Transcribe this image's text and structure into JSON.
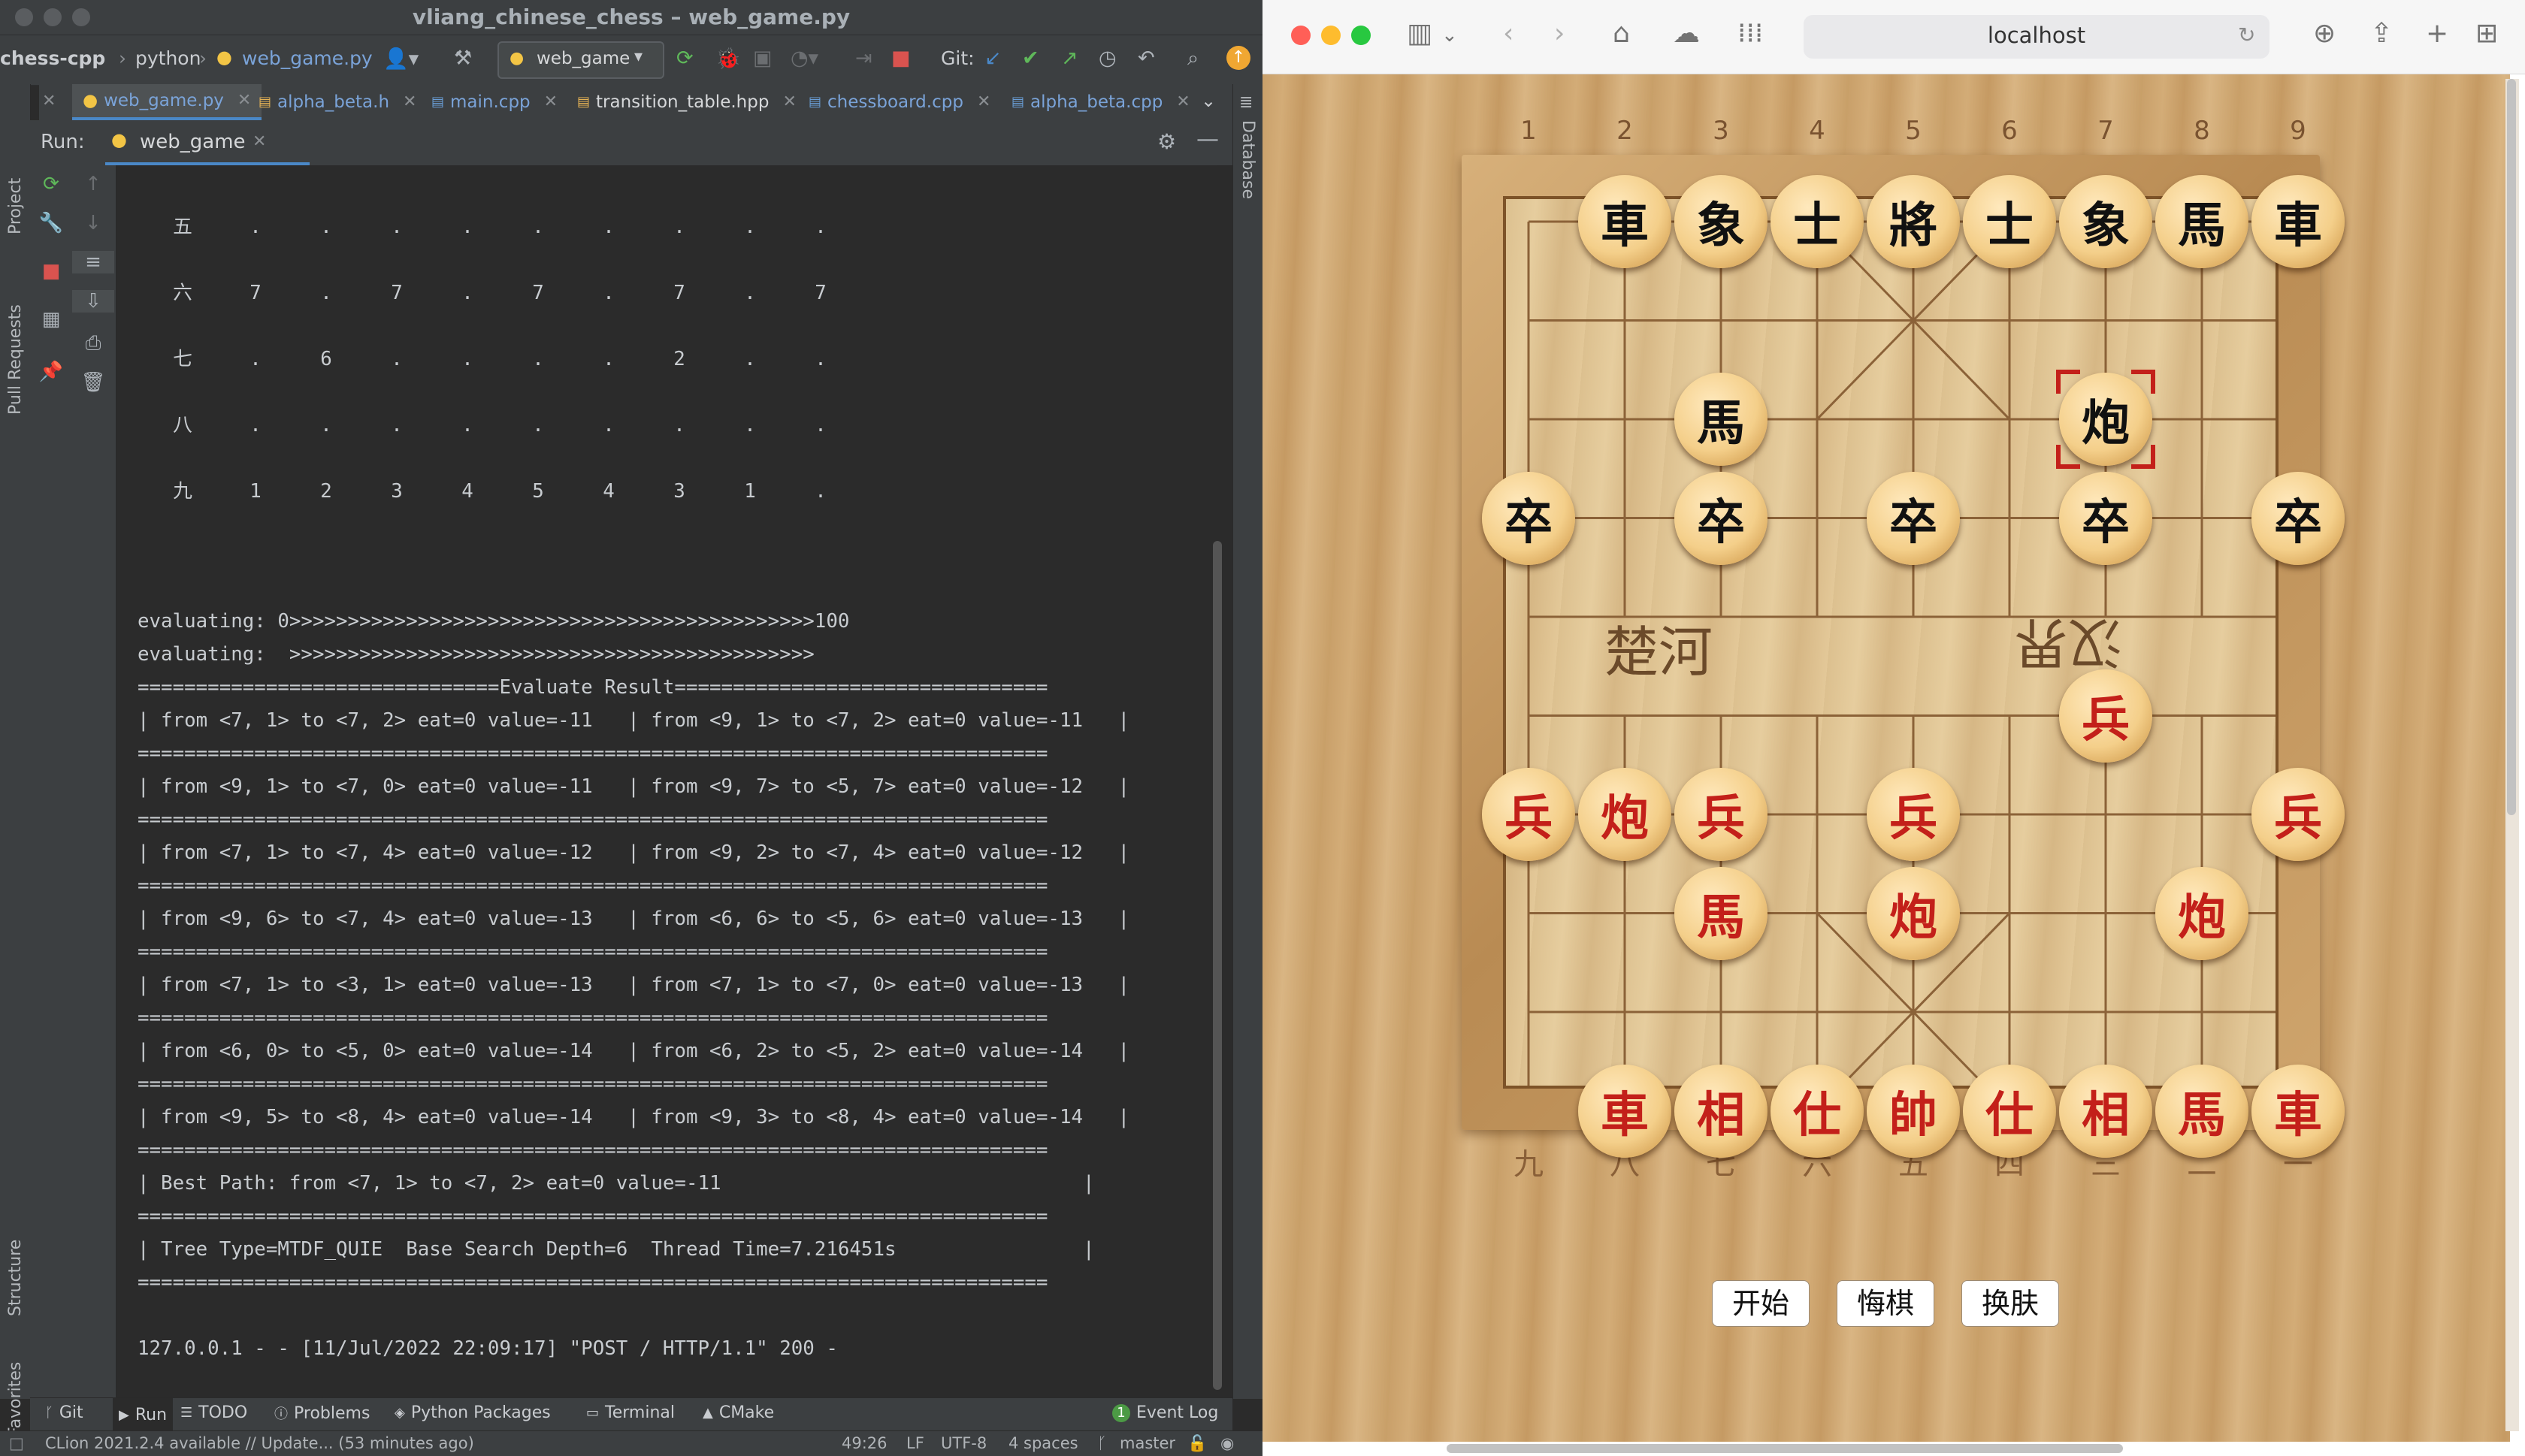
{
  "ide": {
    "title": "vliang_chinese_chess – web_game.py",
    "breadcrumb": {
      "project": "chess-cpp",
      "folder": "python",
      "file": "web_game.py"
    },
    "run_config": "web_game",
    "git_label": "Git:",
    "tabs": [
      {
        "label": "web_game.py",
        "active": true
      },
      {
        "label": "alpha_beta.h",
        "active": false
      },
      {
        "label": "main.cpp",
        "active": false
      },
      {
        "label": "transition_table.hpp",
        "active": false
      },
      {
        "label": "chessboard.cpp",
        "active": false
      },
      {
        "label": "alpha_beta.cpp",
        "active": false
      }
    ],
    "left_stripe": {
      "project": "Project",
      "pull_requests": "Pull Requests",
      "structure": "Structure",
      "favorites": "Favorites"
    },
    "right_stripe": {
      "database": "Database"
    },
    "run_label": "Run:",
    "run_tab": "web_game",
    "console": {
      "board_rows": [
        {
          "label": "五",
          "cells": [
            ".",
            ".",
            ".",
            ".",
            ".",
            ".",
            ".",
            ".",
            "."
          ]
        },
        {
          "label": "六",
          "cells": [
            "7",
            ".",
            "7",
            ".",
            "7",
            ".",
            "7",
            ".",
            "7"
          ]
        },
        {
          "label": "七",
          "cells": [
            ".",
            "6",
            ".",
            ".",
            ".",
            ".",
            "2",
            ".",
            "."
          ]
        },
        {
          "label": "八",
          "cells": [
            ".",
            ".",
            ".",
            ".",
            ".",
            ".",
            ".",
            ".",
            "."
          ]
        },
        {
          "label": "九",
          "cells": [
            "1",
            "2",
            "3",
            "4",
            "5",
            "4",
            "3",
            "1",
            "."
          ]
        }
      ],
      "lines": [
        "evaluating: 0>>>>>>>>>>>>>>>>>>>>>>>>>>>>>>>>>>>>>>>>>>>>>100",
        "evaluating:  >>>>>>>>>>>>>>>>>>>>>>>>>>>>>>>>>>>>>>>>>>>>>",
        "===============================Evaluate Result================================",
        "| from <7, 1> to <7, 2> eat=0 value=-11   | from <9, 1> to <7, 2> eat=0 value=-11   |",
        "==============================================================================",
        "| from <9, 1> to <7, 0> eat=0 value=-11   | from <9, 7> to <5, 7> eat=0 value=-12   |",
        "==============================================================================",
        "| from <7, 1> to <7, 4> eat=0 value=-12   | from <9, 2> to <7, 4> eat=0 value=-12   |",
        "==============================================================================",
        "| from <9, 6> to <7, 4> eat=0 value=-13   | from <6, 6> to <5, 6> eat=0 value=-13   |",
        "==============================================================================",
        "| from <7, 1> to <3, 1> eat=0 value=-13   | from <7, 1> to <7, 0> eat=0 value=-13   |",
        "==============================================================================",
        "| from <6, 0> to <5, 0> eat=0 value=-14   | from <6, 2> to <5, 2> eat=0 value=-14   |",
        "==============================================================================",
        "| from <9, 5> to <8, 4> eat=0 value=-14   | from <9, 3> to <8, 4> eat=0 value=-14   |",
        "==============================================================================",
        "| Best Path: from <7, 1> to <7, 2> eat=0 value=-11                               |",
        "==============================================================================",
        "| Tree Type=MTDF_QUIE  Base Search Depth=6  Thread Time=7.216451s                |",
        "==============================================================================",
        "",
        "127.0.0.1 - - [11/Jul/2022 22:09:17] \"POST / HTTP/1.1\" 200 -"
      ]
    },
    "bottom_tools": [
      {
        "label": "Git",
        "icon": "branch-icon",
        "active": false
      },
      {
        "label": "Run",
        "icon": "play-icon",
        "active": true
      },
      {
        "label": "TODO",
        "icon": "list-icon",
        "active": false
      },
      {
        "label": "Problems",
        "icon": "info-icon",
        "active": false
      },
      {
        "label": "Python Packages",
        "icon": "layers-icon",
        "active": false
      },
      {
        "label": "Terminal",
        "icon": "terminal-icon",
        "active": false
      },
      {
        "label": "CMake",
        "icon": "triangle-icon",
        "active": false
      }
    ],
    "event_log": {
      "count": "1",
      "label": "Event Log"
    },
    "status": {
      "message": "CLion 2021.2.4 available // Update... (53 minutes ago)",
      "position": "49:26",
      "line_sep": "LF",
      "encoding": "UTF-8",
      "indent": "4 spaces",
      "branch": "master"
    }
  },
  "browser": {
    "url": "localhost",
    "files_top": [
      "1",
      "2",
      "3",
      "4",
      "5",
      "6",
      "7",
      "8",
      "9"
    ],
    "files_bottom": [
      "九",
      "八",
      "七",
      "六",
      "五",
      "四",
      "三",
      "二",
      "一"
    ],
    "river": {
      "left": "楚河",
      "right": "汉界"
    },
    "pieces": [
      {
        "t": "車",
        "c": "black",
        "f": 1,
        "r": 0
      },
      {
        "t": "象",
        "c": "black",
        "f": 2,
        "r": 0
      },
      {
        "t": "士",
        "c": "black",
        "f": 3,
        "r": 0
      },
      {
        "t": "將",
        "c": "black",
        "f": 4,
        "r": 0
      },
      {
        "t": "士",
        "c": "black",
        "f": 5,
        "r": 0
      },
      {
        "t": "象",
        "c": "black",
        "f": 6,
        "r": 0
      },
      {
        "t": "馬",
        "c": "black",
        "f": 7,
        "r": 0
      },
      {
        "t": "車",
        "c": "black",
        "f": 8,
        "r": 0
      },
      {
        "t": "馬",
        "c": "black",
        "f": 2,
        "r": 2
      },
      {
        "t": "炮",
        "c": "black",
        "f": 6,
        "r": 2
      },
      {
        "t": "卒",
        "c": "black",
        "f": 0,
        "r": 3
      },
      {
        "t": "卒",
        "c": "black",
        "f": 2,
        "r": 3
      },
      {
        "t": "卒",
        "c": "black",
        "f": 4,
        "r": 3
      },
      {
        "t": "卒",
        "c": "black",
        "f": 6,
        "r": 3
      },
      {
        "t": "卒",
        "c": "black",
        "f": 8,
        "r": 3
      },
      {
        "t": "兵",
        "c": "red",
        "f": 6,
        "r": 5
      },
      {
        "t": "兵",
        "c": "red",
        "f": 0,
        "r": 6
      },
      {
        "t": "炮",
        "c": "red",
        "f": 1,
        "r": 6
      },
      {
        "t": "兵",
        "c": "red",
        "f": 2,
        "r": 6
      },
      {
        "t": "兵",
        "c": "red",
        "f": 4,
        "r": 6
      },
      {
        "t": "兵",
        "c": "red",
        "f": 8,
        "r": 6
      },
      {
        "t": "馬",
        "c": "red",
        "f": 2,
        "r": 7
      },
      {
        "t": "炮",
        "c": "red",
        "f": 4,
        "r": 7
      },
      {
        "t": "炮",
        "c": "red",
        "f": 7,
        "r": 7
      },
      {
        "t": "車",
        "c": "red",
        "f": 1,
        "r": 9
      },
      {
        "t": "相",
        "c": "red",
        "f": 2,
        "r": 9
      },
      {
        "t": "仕",
        "c": "red",
        "f": 3,
        "r": 9
      },
      {
        "t": "帥",
        "c": "red",
        "f": 4,
        "r": 9
      },
      {
        "t": "仕",
        "c": "red",
        "f": 5,
        "r": 9
      },
      {
        "t": "相",
        "c": "red",
        "f": 6,
        "r": 9
      },
      {
        "t": "馬",
        "c": "red",
        "f": 7,
        "r": 9
      },
      {
        "t": "車",
        "c": "red",
        "f": 8,
        "r": 9
      }
    ],
    "selected": {
      "f": 6,
      "r": 2
    },
    "buttons": {
      "start": "开始",
      "undo": "悔棋",
      "skin": "换肤"
    }
  },
  "colors": {
    "accent": "#4a88c7",
    "red_piece": "#c3201a",
    "black_piece": "#111111",
    "tl_red": "#ff5f57",
    "tl_yellow": "#febc2e",
    "tl_green": "#28c840"
  }
}
